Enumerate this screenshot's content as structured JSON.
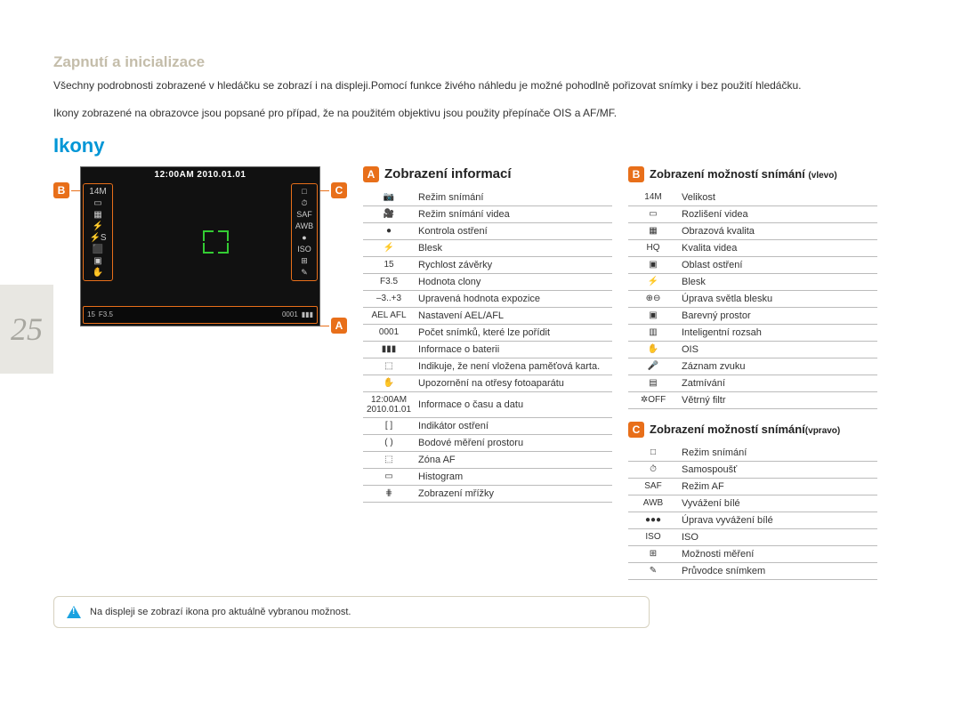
{
  "pageNumber": "25",
  "sectionLabel": "Zapnutí a inicializace",
  "intro1": "Všechny podrobnosti zobrazené v hledáčku se zobrazí i na displeji.Pomocí funkce živého náhledu je možné pohodlně pořizovat snímky i bez použití hledáčku.",
  "intro2": "Ikony zobrazené na obrazovce jsou popsané pro případ, že na použitém objektivu jsou použity přepínače OIS a AF/MF.",
  "title": "Ikony",
  "labels": {
    "A": "A",
    "B": "B",
    "C": "C"
  },
  "lcd": {
    "timestamp": "12:00AM 2010.01.01",
    "shutter": "15",
    "aperture": "F3.5",
    "count": "0001",
    "rightIcons": [
      "□",
      "⏱",
      "SAF",
      "AWB",
      "●",
      "ISO",
      "⊞",
      "✎"
    ],
    "leftIcons": [
      "14M",
      "▭",
      "▦",
      "⚡",
      "⚡S",
      "⬛",
      "▣",
      "✋"
    ]
  },
  "sectionA": {
    "title": "Zobrazení informací",
    "rows": [
      {
        "icon": "📷",
        "label": "Režim snímání"
      },
      {
        "icon": "🎥",
        "label": "Režim snímání videa"
      },
      {
        "icon": "●",
        "label": "Kontrola ostření"
      },
      {
        "icon": "⚡",
        "label": "Blesk"
      },
      {
        "icon": "15",
        "label": "Rychlost závěrky"
      },
      {
        "icon": "F3.5",
        "label": "Hodnota clony"
      },
      {
        "icon": "–3..+3",
        "label": "Upravená hodnota expozice"
      },
      {
        "icon": "AEL AFL",
        "label": "Nastavení AEL/AFL"
      },
      {
        "icon": "0001",
        "label": "Počet snímků, které lze pořídit"
      },
      {
        "icon": "▮▮▮",
        "label": "Informace o baterii"
      },
      {
        "icon": "⬚",
        "label": "Indikuje, že není vložena paměťová karta."
      },
      {
        "icon": "✋",
        "label": "Upozornění na otřesy fotoaparátu"
      },
      {
        "icon": "12:00AM 2010.01.01",
        "label": "Informace o času a datu"
      },
      {
        "icon": "[ ]",
        "label": "Indikátor ostření"
      },
      {
        "icon": "( )",
        "label": "Bodové měření prostoru"
      },
      {
        "icon": "⬚",
        "label": "Zóna AF"
      },
      {
        "icon": "▭",
        "label": "Histogram"
      },
      {
        "icon": "⋕",
        "label": "Zobrazení mřížky"
      }
    ]
  },
  "sectionB": {
    "title": "Zobrazení možností snímání",
    "titleSuffix": "(vlevo)",
    "rows": [
      {
        "icon": "14M",
        "label": "Velikost"
      },
      {
        "icon": "▭",
        "label": "Rozlišení videa"
      },
      {
        "icon": "▦",
        "label": "Obrazová kvalita"
      },
      {
        "icon": "HQ",
        "label": "Kvalita videa"
      },
      {
        "icon": "▣",
        "label": "Oblast ostření"
      },
      {
        "icon": "⚡",
        "label": "Blesk"
      },
      {
        "icon": "⊕⊖",
        "label": "Úprava světla blesku"
      },
      {
        "icon": "▣",
        "label": "Barevný prostor"
      },
      {
        "icon": "▥",
        "label": "Inteligentní rozsah"
      },
      {
        "icon": "✋",
        "label": "OIS"
      },
      {
        "icon": "🎤",
        "label": "Záznam zvuku"
      },
      {
        "icon": "▤",
        "label": "Zatmívání"
      },
      {
        "icon": "✲OFF",
        "label": "Větrný filtr"
      }
    ]
  },
  "sectionC": {
    "title": "Zobrazení možností snímání",
    "titleSuffix": "(vpravo)",
    "rows": [
      {
        "icon": "□",
        "label": "Režim snímání"
      },
      {
        "icon": "⏱",
        "label": "Samospoušť"
      },
      {
        "icon": "SAF",
        "label": "Režim AF"
      },
      {
        "icon": "AWB",
        "label": "Vyvážení bílé"
      },
      {
        "icon": "●●●",
        "label": "Úprava vyvážení bílé"
      },
      {
        "icon": "ISO",
        "label": "ISO"
      },
      {
        "icon": "⊞",
        "label": "Možnosti měření"
      },
      {
        "icon": "✎",
        "label": "Průvodce snímkem"
      }
    ]
  },
  "note": "Na displeji se zobrazí ikona pro aktuálně vybranou možnost."
}
